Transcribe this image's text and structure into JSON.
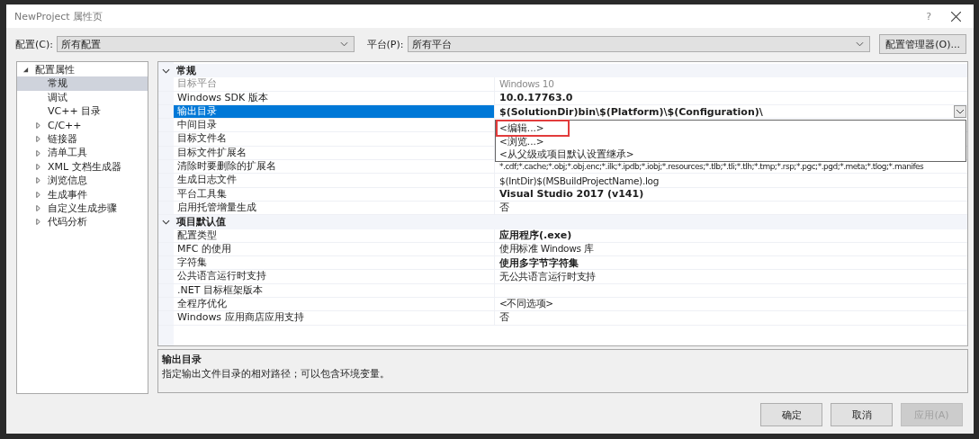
{
  "window": {
    "title": "NewProject 属性页",
    "help": "?"
  },
  "toolbar": {
    "config_label": "配置(C):",
    "config_value": "所有配置",
    "platform_label": "平台(P):",
    "platform_value": "所有平台",
    "manager_button": "配置管理器(O)..."
  },
  "tree": [
    {
      "label": "配置属性",
      "kind": "group",
      "expanded": true,
      "selected": false,
      "children": [
        {
          "label": "常规",
          "kind": "page",
          "selected": true
        },
        {
          "label": "调试",
          "kind": "page",
          "selected": false
        },
        {
          "label": "VC++ 目录",
          "kind": "page",
          "selected": false
        },
        {
          "label": "C/C++",
          "kind": "group",
          "expanded": false,
          "selected": false
        },
        {
          "label": "链接器",
          "kind": "group",
          "expanded": false,
          "selected": false
        },
        {
          "label": "清单工具",
          "kind": "group",
          "expanded": false,
          "selected": false
        },
        {
          "label": "XML 文档生成器",
          "kind": "group",
          "expanded": false,
          "selected": false
        },
        {
          "label": "浏览信息",
          "kind": "group",
          "expanded": false,
          "selected": false
        },
        {
          "label": "生成事件",
          "kind": "group",
          "expanded": false,
          "selected": false
        },
        {
          "label": "自定义生成步骤",
          "kind": "group",
          "expanded": false,
          "selected": false
        },
        {
          "label": "代码分析",
          "kind": "group",
          "expanded": false,
          "selected": false
        }
      ]
    }
  ],
  "grid": {
    "sections": [
      {
        "title": "常规",
        "expanded": true,
        "rows": [
          {
            "name": "目标平台",
            "value": "Windows 10",
            "disabled": true,
            "selected": false
          },
          {
            "name": "Windows SDK 版本",
            "value": "10.0.17763.0",
            "bold": true,
            "disabled": false,
            "selected": false
          },
          {
            "name": "输出目录",
            "value": "$(SolutionDir)bin\\$(Platform)\\$(Configuration)\\",
            "bold": true,
            "disabled": false,
            "selected": true
          },
          {
            "name": "中间目录",
            "disabled": false,
            "selected": false
          },
          {
            "name": "目标文件名",
            "disabled": false,
            "selected": false
          },
          {
            "name": "目标文件扩展名",
            "disabled": false,
            "selected": false
          },
          {
            "name": "清除时要删除的扩展名",
            "value": "*.cdf;*.cache;*.obj;*.obj.enc;*.ilk;*.ipdb;*.iobj;*.resources;*.tlb;*.tli;*.tlh;*.tmp;*.rsp;*.pgc;*.pgd;*.meta;*.tlog;*.manifes",
            "disabled": false,
            "selected": false
          },
          {
            "name": "生成日志文件",
            "value": "$(IntDir)$(MSBuildProjectName).log",
            "disabled": false,
            "selected": false
          },
          {
            "name": "平台工具集",
            "value": "Visual Studio 2017 (v141)",
            "bold": true,
            "disabled": false,
            "selected": false
          },
          {
            "name": "启用托管增量生成",
            "value": "否",
            "disabled": false,
            "selected": false
          }
        ]
      },
      {
        "title": "项目默认值",
        "expanded": true,
        "rows": [
          {
            "name": "配置类型",
            "value": "应用程序(.exe)",
            "bold": true,
            "disabled": false,
            "selected": false
          },
          {
            "name": "MFC 的使用",
            "value": "使用标准 Windows 库",
            "disabled": false,
            "selected": false
          },
          {
            "name": "字符集",
            "value": "使用多字节字符集",
            "bold": true,
            "disabled": false,
            "selected": false
          },
          {
            "name": "公共语言运行时支持",
            "value": "无公共语言运行时支持",
            "disabled": false,
            "selected": false
          },
          {
            "name": ".NET 目标框架版本",
            "disabled": false,
            "selected": false
          },
          {
            "name": "全程序优化",
            "value": "<不同选项>",
            "disabled": false,
            "selected": false
          },
          {
            "name": "Windows 应用商店应用支持",
            "value": "否",
            "disabled": false,
            "selected": false
          }
        ]
      }
    ]
  },
  "dropdown_options": [
    {
      "label": "<编辑...>",
      "highlighted": true
    },
    {
      "label": "<浏览...>",
      "highlighted": false
    },
    {
      "label": "<从父级或项目默认设置继承>",
      "highlighted": false
    }
  ],
  "description": {
    "title": "输出目录",
    "text": "指定输出文件目录的相对路径；可以包含环境变量。"
  },
  "buttons": [
    {
      "label": "确定",
      "disabled": false
    },
    {
      "label": "取消",
      "disabled": false
    },
    {
      "label": "应用(A)",
      "disabled": true
    }
  ]
}
